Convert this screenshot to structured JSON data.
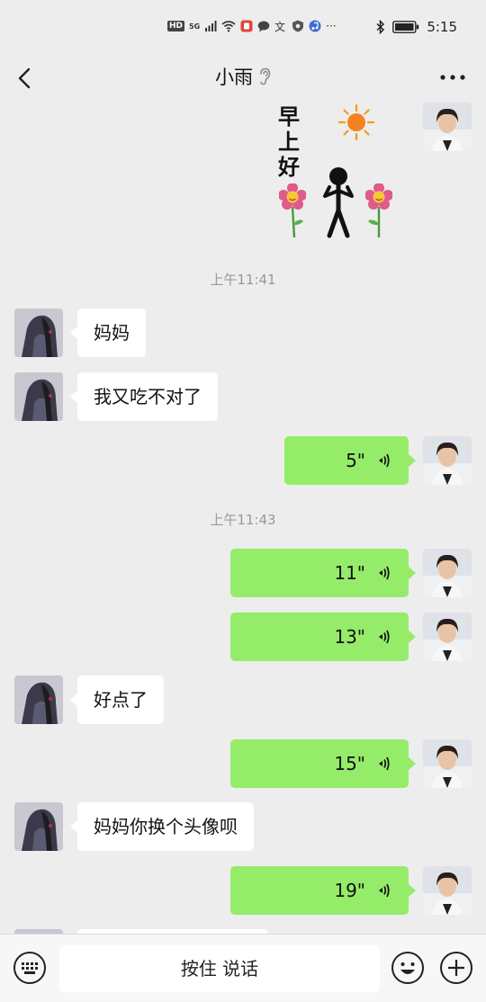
{
  "status_bar": {
    "network_badge": "HD",
    "network_type": "5G",
    "time": "5:15",
    "icons": [
      "hd-icon",
      "signal-icon",
      "wifi-icon",
      "app-notification-icon",
      "message-icon",
      "translate-icon",
      "shield-icon",
      "music-icon",
      "more-notifications-icon",
      "bluetooth-icon",
      "battery-icon"
    ],
    "ellipsis": "···"
  },
  "nav": {
    "title": "小雨",
    "back_icon": "chevron-left-icon",
    "earpiece_icon": "ear-icon",
    "more_icon": "more-dots-icon"
  },
  "sticker": {
    "text": "早上好",
    "icons": [
      "sun-icon",
      "stick-figure-icon",
      "flower-icon"
    ]
  },
  "messages": [
    {
      "type": "time",
      "text": "上午11:41"
    },
    {
      "type": "text",
      "side": "left",
      "text": "妈妈"
    },
    {
      "type": "text",
      "side": "left",
      "text": "我又吃不对了"
    },
    {
      "type": "voice",
      "side": "right",
      "duration": "5\""
    },
    {
      "type": "time",
      "text": "上午11:43"
    },
    {
      "type": "voice",
      "side": "right",
      "duration": "11\""
    },
    {
      "type": "voice",
      "side": "right",
      "duration": "13\""
    },
    {
      "type": "text",
      "side": "left",
      "text": "好点了"
    },
    {
      "type": "voice",
      "side": "right",
      "duration": "15\""
    },
    {
      "type": "text",
      "side": "left",
      "text": "妈妈你换个头像呗"
    },
    {
      "type": "voice",
      "side": "right",
      "duration": "19\""
    }
  ],
  "input_bar": {
    "keyboard_icon": "keyboard-icon",
    "hold_to_talk_label": "按住 说话",
    "emoji_icon": "emoji-icon",
    "plus_icon": "plus-icon"
  },
  "colors": {
    "background": "#ededed",
    "green_bubble": "#95ec69",
    "white_bubble": "#ffffff",
    "timestamp": "#999999"
  }
}
